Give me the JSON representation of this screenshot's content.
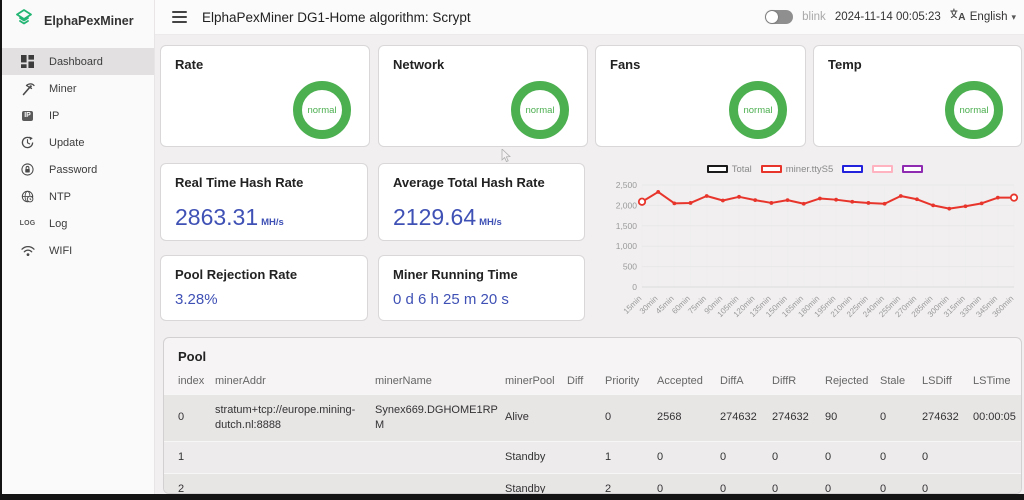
{
  "header": {
    "title": "ElphaPexMiner DG1-Home algorithm: Scrypt",
    "blink_label": "blink",
    "datetime": "2024-11-14 00:05:23",
    "language": "English"
  },
  "sidebar": {
    "brand": "ElphaPexMiner",
    "items": [
      {
        "label": "Dashboard"
      },
      {
        "label": "Miner"
      },
      {
        "label": "IP"
      },
      {
        "label": "Update"
      },
      {
        "label": "Password"
      },
      {
        "label": "NTP"
      },
      {
        "label": "Log"
      },
      {
        "label": "WIFI"
      }
    ]
  },
  "status_cards": [
    {
      "title": "Rate",
      "status": "normal"
    },
    {
      "title": "Network",
      "status": "normal"
    },
    {
      "title": "Fans",
      "status": "normal"
    },
    {
      "title": "Temp",
      "status": "normal"
    }
  ],
  "metric_cards": [
    {
      "title": "Real Time Hash Rate",
      "value": "2863.31",
      "unit": "MH/s"
    },
    {
      "title": "Average Total Hash Rate",
      "value": "2129.64",
      "unit": "MH/s"
    },
    {
      "title": "Pool Rejection Rate",
      "value": "3.28%",
      "unit": ""
    },
    {
      "title": "Miner Running Time",
      "value": "0 d 6 h 25 m 20 s",
      "unit": ""
    }
  ],
  "colors": {
    "brand_green": "#22b573",
    "status_green": "#4caf50",
    "metric_blue": "#3f51b5",
    "line_red": "#e8352c"
  },
  "chart_data": {
    "type": "line",
    "title": "",
    "xlabel": "",
    "ylabel": "",
    "x": [
      "15min",
      "30min",
      "45min",
      "60min",
      "75min",
      "90min",
      "105min",
      "120min",
      "135min",
      "150min",
      "165min",
      "180min",
      "195min",
      "210min",
      "225min",
      "240min",
      "255min",
      "270min",
      "285min",
      "300min",
      "315min",
      "330min",
      "345min",
      "360min"
    ],
    "ylim": [
      0,
      2500
    ],
    "yticks": [
      0,
      500,
      1000,
      1500,
      2000,
      2500
    ],
    "ytick_labels": [
      "0",
      "500",
      "1,000",
      "1,500",
      "2,000",
      "2,500"
    ],
    "grid": true,
    "legend_position": "top",
    "series": [
      {
        "name": "Total",
        "color": "#1a1a1a",
        "values": []
      },
      {
        "name": "miner.ttyS5",
        "color": "#e8352c",
        "values": [
          2090,
          2330,
          2050,
          2060,
          2230,
          2120,
          2210,
          2130,
          2060,
          2130,
          2040,
          2170,
          2140,
          2090,
          2060,
          2040,
          2230,
          2150,
          2000,
          1920,
          1980,
          2050,
          2190,
          2190
        ]
      },
      {
        "name": "",
        "color": "#2222dd",
        "values": []
      },
      {
        "name": "",
        "color": "#ffb3c1",
        "values": []
      },
      {
        "name": "",
        "color": "#8e2bb0",
        "values": []
      }
    ]
  },
  "pool": {
    "title": "Pool",
    "columns": [
      "index",
      "minerAddr",
      "minerName",
      "minerPool",
      "Diff",
      "Priority",
      "Accepted",
      "DiffA",
      "DiffR",
      "Rejected",
      "Stale",
      "LSDiff",
      "LSTime"
    ],
    "rows": [
      [
        "0",
        "stratum+tcp://europe.mining-dutch.nl:8888",
        "Synex669.DGHOME1RPM",
        "Alive",
        "",
        "0",
        "2568",
        "274632",
        "274632",
        "90",
        "0",
        "274632",
        "00:00:05"
      ],
      [
        "1",
        "",
        "",
        "Standby",
        "",
        "1",
        "0",
        "0",
        "0",
        "0",
        "0",
        "0",
        ""
      ],
      [
        "2",
        "",
        "",
        "Standby",
        "",
        "2",
        "0",
        "0",
        "0",
        "0",
        "0",
        "0",
        ""
      ]
    ]
  }
}
